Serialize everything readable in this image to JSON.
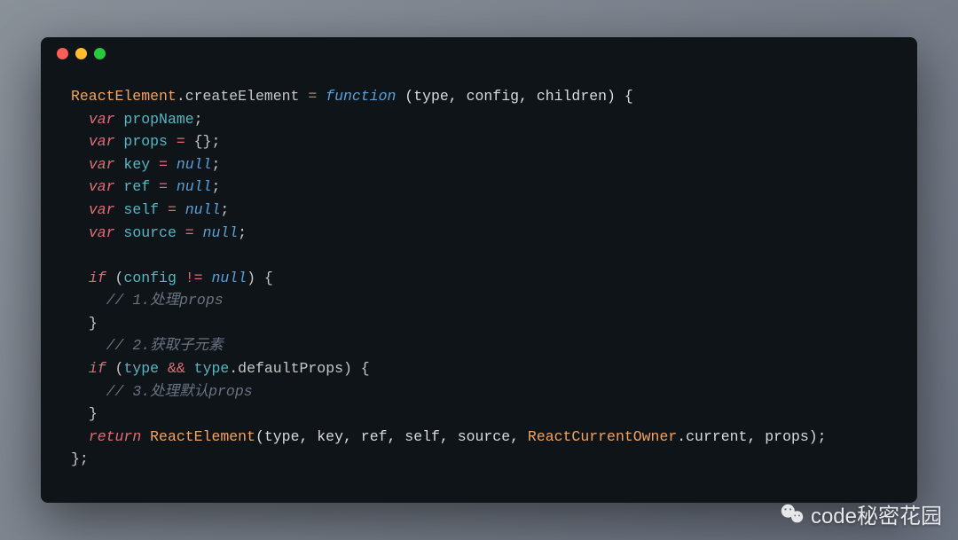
{
  "window": {
    "dots": [
      "red",
      "yellow",
      "green"
    ]
  },
  "code": {
    "l1": {
      "t1": "ReactElement",
      "t2": ".createElement ",
      "t3": "=",
      "t4": " function",
      "t5": " (type, config, children) {"
    },
    "l2": {
      "indent": "  ",
      "t1": "var",
      "t2": " propName",
      "t3": ";"
    },
    "l3": {
      "indent": "  ",
      "t1": "var",
      "t2": " props ",
      "t3": "=",
      "t4": " {};"
    },
    "l4": {
      "indent": "  ",
      "t1": "var",
      "t2": " key ",
      "t3": "=",
      "t4": " null",
      "t5": ";"
    },
    "l5": {
      "indent": "  ",
      "t1": "var",
      "t2": " ref ",
      "t3": "=",
      "t4": " null",
      "t5": ";"
    },
    "l6": {
      "indent": "  ",
      "t1": "var",
      "t2": " self ",
      "t3": "=",
      "t4": " null",
      "t5": ";"
    },
    "l7": {
      "indent": "  ",
      "t1": "var",
      "t2": " source ",
      "t3": "=",
      "t4": " null",
      "t5": ";"
    },
    "blank1": " ",
    "l8": {
      "indent": "  ",
      "t1": "if",
      "t2": " (",
      "t3": "config ",
      "t4": "!=",
      "t5": " null",
      "t6": ") {"
    },
    "l9": {
      "indent": "    ",
      "t1": "// 1.处理props"
    },
    "l10": {
      "indent": "  ",
      "t1": "}"
    },
    "l11": {
      "indent": "    ",
      "t1": "// 2.获取子元素"
    },
    "l12": {
      "indent": "  ",
      "t1": "if",
      "t2": " (",
      "t3": "type ",
      "t4": "&&",
      "t5": " type",
      "t6": ".defaultProps) {"
    },
    "l13": {
      "indent": "    ",
      "t1": "// 3.处理默认props"
    },
    "l14": {
      "indent": "  ",
      "t1": "}"
    },
    "l15": {
      "indent": "  ",
      "t1": "return",
      "t2": " ReactElement",
      "t3": "(type, key, ref, self, source, ",
      "t4": "ReactCurrentOwner",
      "t5": ".current, props);"
    },
    "l16": {
      "t1": "};"
    }
  },
  "watermark": {
    "icon": "wechat-icon",
    "text": "code秘密花园"
  }
}
